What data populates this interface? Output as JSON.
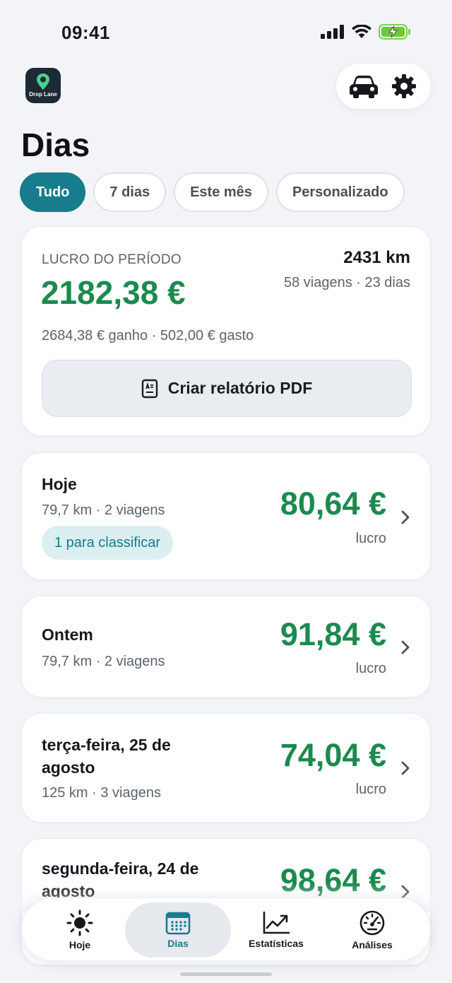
{
  "status_bar": {
    "time": "09:41"
  },
  "app": {
    "logo_text": "Drop Lane"
  },
  "header": {
    "title": "Dias"
  },
  "filters": [
    {
      "label": "Tudo",
      "active": true
    },
    {
      "label": "7 dias",
      "active": false
    },
    {
      "label": "Este mês",
      "active": false
    },
    {
      "label": "Personalizado",
      "active": false
    }
  ],
  "summary": {
    "label": "LUCRO DO PERÍODO",
    "profit": "2182,38 €",
    "km": "2431 km",
    "trips_days": "58 viagens · 23 dias",
    "breakdown": "2684,38 € ganho · 502,00 € gasto",
    "pdf_button": "Criar relatório PDF"
  },
  "days": [
    {
      "title": "Hoje",
      "sub": "79,7 km · 2 viagens",
      "amount": "80,64 €",
      "amount_label": "lucro",
      "badge": "1 para classificar"
    },
    {
      "title": "Ontem",
      "sub": "79,7 km · 2 viagens",
      "amount": "91,84 €",
      "amount_label": "lucro"
    },
    {
      "title": "terça-feira, 25 de agosto",
      "sub": "125 km · 3 viagens",
      "amount": "74,04 €",
      "amount_label": "lucro"
    },
    {
      "title": "segunda-feira, 24 de agosto",
      "sub": "",
      "amount": "98,64 €",
      "amount_label": ""
    }
  ],
  "tabs": [
    {
      "label": "Hoje",
      "icon": "sun-icon"
    },
    {
      "label": "Dias",
      "icon": "calendar-icon",
      "active": true
    },
    {
      "label": "Estatísticas",
      "icon": "chart-line-icon"
    },
    {
      "label": "Análises",
      "icon": "gauge-icon"
    }
  ],
  "colors": {
    "accent": "#177c8c",
    "profit_green": "#1c8a4f",
    "background": "#f2f4f8"
  }
}
